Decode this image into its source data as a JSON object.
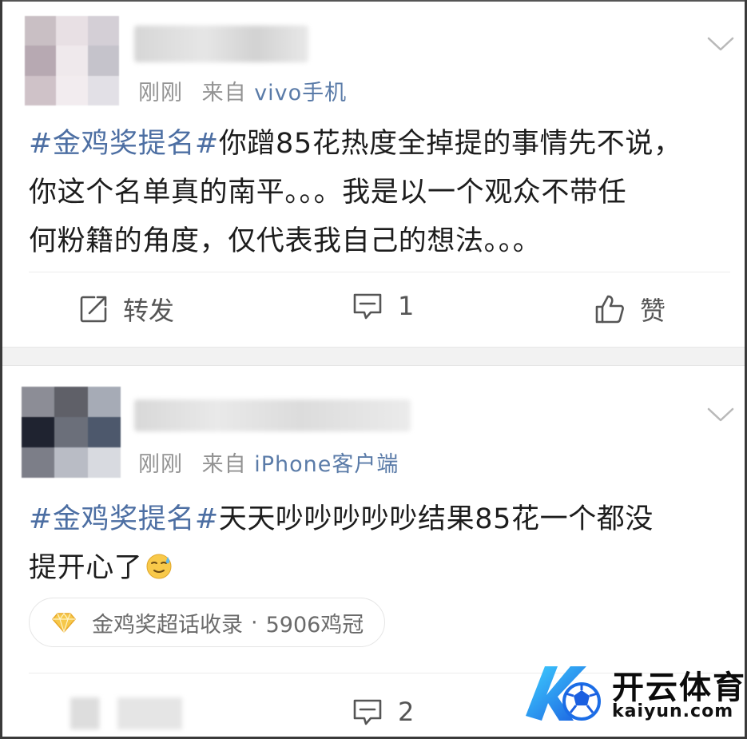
{
  "posts": [
    {
      "time": "刚刚",
      "source_prefix": "来自",
      "source": "vivo手机",
      "hashtag": "#金鸡奖提名#",
      "body_line1": "你蹭85花热度全掉提的事情先不说，",
      "body_line2": "你这个名单真的南平。。。我是以一个观众不带任",
      "body_line3": "何粉籍的角度，仅代表我自己的想法。。。",
      "actions": {
        "repost_label": "转发",
        "comment_count": "1",
        "like_label": "赞"
      }
    },
    {
      "time": "刚刚",
      "source_prefix": "来自",
      "source": "iPhone客户端",
      "hashtag": "#金鸡奖提名#",
      "body_line1": "天天吵吵吵吵吵结果85花一个都没",
      "body_line2": "提开心了",
      "topic": {
        "name": "金鸡奖超话收录",
        "separator": "·",
        "stat": "5906鸡冠"
      },
      "actions": {
        "comment_count": "2"
      }
    }
  ],
  "watermark": {
    "title": "开云体育",
    "url": "kaiyun.com"
  },
  "colors": {
    "hashtag": "#4d6fa3",
    "meta_text": "#939393",
    "source_link": "#5a7ba8",
    "action_text": "#555555",
    "separator_band": "#f2f2f2"
  }
}
